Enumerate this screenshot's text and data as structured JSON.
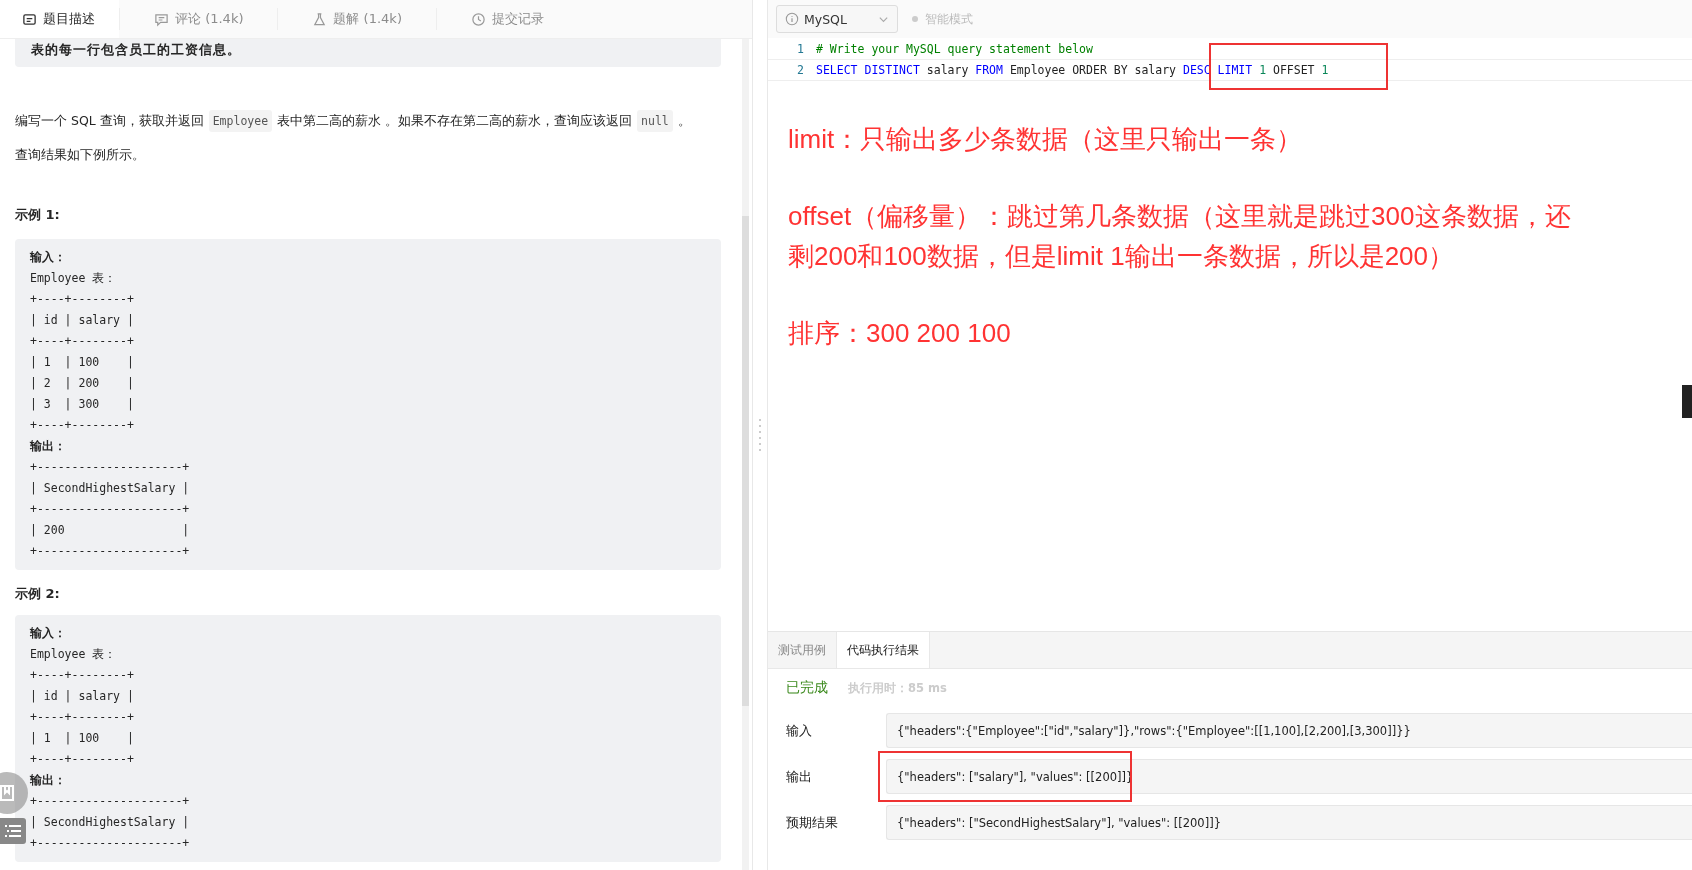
{
  "left_tabs": [
    {
      "label": "题目描述",
      "selected": true
    },
    {
      "label": "评论 (1.4k)",
      "selected": false
    },
    {
      "label": "题解 (1.4k)",
      "selected": false
    },
    {
      "label": "提交记录",
      "selected": false
    }
  ],
  "top_note": "表的每一行包含员工的工资信息。",
  "description": [
    {
      "kind": "text",
      "text": "编写一个 SQL 查询，获取并返回"
    },
    {
      "kind": "code",
      "text": "Employee"
    },
    {
      "kind": "text",
      "text": "表中第二高的薪水 。如果不存在第二高的薪水，查询应该返回"
    },
    {
      "kind": "code",
      "text": "null"
    },
    {
      "kind": "text",
      "text": "。"
    }
  ],
  "note": "查询结果如下例所示。",
  "examples": [
    {
      "title": "示例 1:",
      "lines": [
        {
          "kind": "label",
          "text": "输入："
        },
        {
          "kind": "text",
          "text": "Employee 表："
        },
        {
          "kind": "text",
          "text": "+----+--------+"
        },
        {
          "kind": "text",
          "text": "| id | salary |"
        },
        {
          "kind": "text",
          "text": "+----+--------+"
        },
        {
          "kind": "text",
          "text": "| 1  | 100    |"
        },
        {
          "kind": "text",
          "text": "| 2  | 200    |"
        },
        {
          "kind": "text",
          "text": "| 3  | 300    |"
        },
        {
          "kind": "text",
          "text": "+----+--------+"
        },
        {
          "kind": "label",
          "text": "输出："
        },
        {
          "kind": "text",
          "text": "+---------------------+"
        },
        {
          "kind": "text",
          "text": "| SecondHighestSalary |"
        },
        {
          "kind": "text",
          "text": "+---------------------+"
        },
        {
          "kind": "text",
          "text": "| 200                 |"
        },
        {
          "kind": "text",
          "text": "+---------------------+"
        }
      ]
    },
    {
      "title": "示例 2:",
      "lines": [
        {
          "kind": "label",
          "text": "输入："
        },
        {
          "kind": "text",
          "text": "Employee 表："
        },
        {
          "kind": "text",
          "text": "+----+--------+"
        },
        {
          "kind": "text",
          "text": "| id | salary |"
        },
        {
          "kind": "text",
          "text": "+----+--------+"
        },
        {
          "kind": "text",
          "text": "| 1  | 100    |"
        },
        {
          "kind": "text",
          "text": "+----+--------+"
        },
        {
          "kind": "label",
          "text": "输出："
        },
        {
          "kind": "text",
          "text": "+---------------------+"
        },
        {
          "kind": "text",
          "text": "| SecondHighestSalary |"
        },
        {
          "kind": "text",
          "text": "+---------------------+"
        }
      ]
    }
  ],
  "language_select": {
    "value": "MySQL"
  },
  "smart_mode": {
    "label": "智能模式",
    "on": false
  },
  "code_lines": [
    {
      "number": "1",
      "tokens": [
        {
          "kind": "comment",
          "text": "# Write your MySQL query statement below"
        }
      ]
    },
    {
      "number": "2",
      "tokens": [
        {
          "kind": "keyword",
          "text": "SELECT DISTINCT"
        },
        {
          "kind": "plain",
          "text": " salary "
        },
        {
          "kind": "keyword",
          "text": "FROM"
        },
        {
          "kind": "plain",
          "text": " Employee ORDER BY salary "
        },
        {
          "kind": "keyword",
          "text": "DESC LIMIT "
        },
        {
          "kind": "number",
          "text": "1"
        },
        {
          "kind": "plain",
          "text": " OFFSET "
        },
        {
          "kind": "number",
          "text": "1"
        }
      ]
    }
  ],
  "annotations": [
    {
      "lines": [
        "limit：只输出多少条数据（这里只输出一条）"
      ]
    },
    {
      "lines": [
        "offset（偏移量）：跳过第几条数据（这里就是跳过300这条数据，还",
        "剩200和100数据，但是limit 1输出一条数据，所以是200）"
      ]
    },
    {
      "lines": [
        "排序：300 200 100"
      ]
    }
  ],
  "result_tabs": [
    {
      "label": "测试用例",
      "selected": false
    },
    {
      "label": "代码执行结果",
      "selected": true
    }
  ],
  "result_status": {
    "state": "已完成",
    "runtime": "执行用时：85 ms"
  },
  "result_rows": [
    {
      "label": "输入",
      "value": "{\"headers\":{\"Employee\":[\"id\",\"salary\"]},\"rows\":{\"Employee\":[[1,100],[2,200],[3,300]]}}",
      "highlighted": false
    },
    {
      "label": "输出",
      "value": "{\"headers\": [\"salary\"], \"values\": [[200]]}",
      "highlighted": true
    },
    {
      "label": "预期结果",
      "value": "{\"headers\": [\"SecondHighestSalary\"], \"values\": [[200]]}",
      "highlighted": false
    }
  ]
}
